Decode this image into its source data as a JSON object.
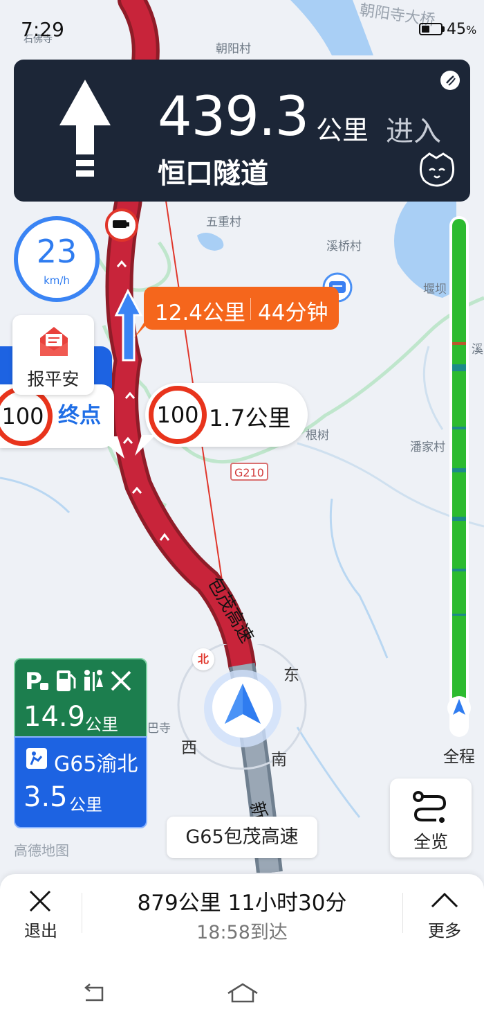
{
  "status_bar": {
    "time": "7:29",
    "battery_percent": "45",
    "battery_unit": "%",
    "battery_level": 0.45
  },
  "guidance": {
    "turn_icon": "straight-arrow-icon",
    "distance": "439.3",
    "distance_unit": "公里",
    "action": "进入",
    "road_name": "恒口隧道"
  },
  "speed": {
    "value": "23",
    "unit": "km/h"
  },
  "route_bubble": {
    "distance": "12.4公里",
    "time": "44分钟"
  },
  "report_safe": {
    "label": "报平安"
  },
  "speed_limit_end": {
    "limit": "100",
    "label": "终点"
  },
  "speed_limit_next": {
    "limit": "100",
    "label": "1.7公里"
  },
  "map": {
    "labels": [
      "朝阳村",
      "朝阳寺大桥",
      "五重村",
      "溪桥村",
      "堰坝",
      "溪",
      "根树",
      "潘家村",
      "巴寺",
      "石佛寺"
    ],
    "road_badge": "G210",
    "road_text_1": "包茂高速",
    "road_text_2": "新"
  },
  "compass": {
    "north": "北",
    "east": "东",
    "south": "南",
    "west": "西"
  },
  "services": {
    "icons": [
      "parking-icon",
      "fuel-icon",
      "restroom-icon",
      "repair-icon"
    ],
    "distance": "14.9",
    "unit": "公里"
  },
  "exit": {
    "icon": "exit-icon",
    "name": "G65渝北",
    "distance": "3.5",
    "unit": "公里"
  },
  "progress": {
    "label": "全程"
  },
  "overview": {
    "label": "全览"
  },
  "current_road": "G65包茂高速",
  "watermark": "高德地图",
  "bottom": {
    "exit_label": "退出",
    "more_label": "更多",
    "summary": "879公里 11小时30分",
    "arrival": "18:58到达"
  },
  "colors": {
    "nav_card": "#1c2637",
    "accent_blue": "#1d63e2",
    "route_red": "#c8243a",
    "eta_orange": "#f5661c",
    "services_green": "#1c7e4e"
  }
}
